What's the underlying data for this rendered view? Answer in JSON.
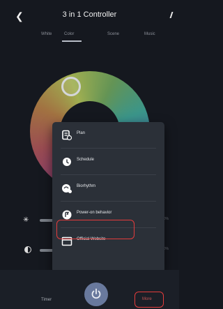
{
  "header": {
    "back_icon": "chevron-left-icon",
    "title": "3 in 1 Controller",
    "edit_icon": "edit-icon"
  },
  "tabs": [
    {
      "label": "White"
    },
    {
      "label": "Color",
      "active": true
    },
    {
      "label": "Scene"
    },
    {
      "label": "Music"
    }
  ],
  "sliders": [
    {
      "icon": "brightness-sun-icon",
      "value": "0%"
    },
    {
      "icon": "contrast-icon",
      "value": "0%"
    }
  ],
  "menu": {
    "items": [
      {
        "label": "Plan",
        "icon": "plan-icon"
      },
      {
        "label": "Schedule",
        "icon": "clock-icon"
      },
      {
        "label": "Biorhythm",
        "icon": "biorhythm-icon"
      },
      {
        "label": "Power-on behavior",
        "icon": "power-on-icon",
        "highlighted": true
      },
      {
        "label": "Official Website",
        "icon": "website-icon"
      }
    ]
  },
  "bottom": {
    "timer_label": "Timer",
    "power_icon": "power-icon",
    "more_label": "More"
  },
  "colors": {
    "background": "#15181f",
    "popup": "#2b3038",
    "highlight": "#e43c3c",
    "power": "#69799d"
  }
}
